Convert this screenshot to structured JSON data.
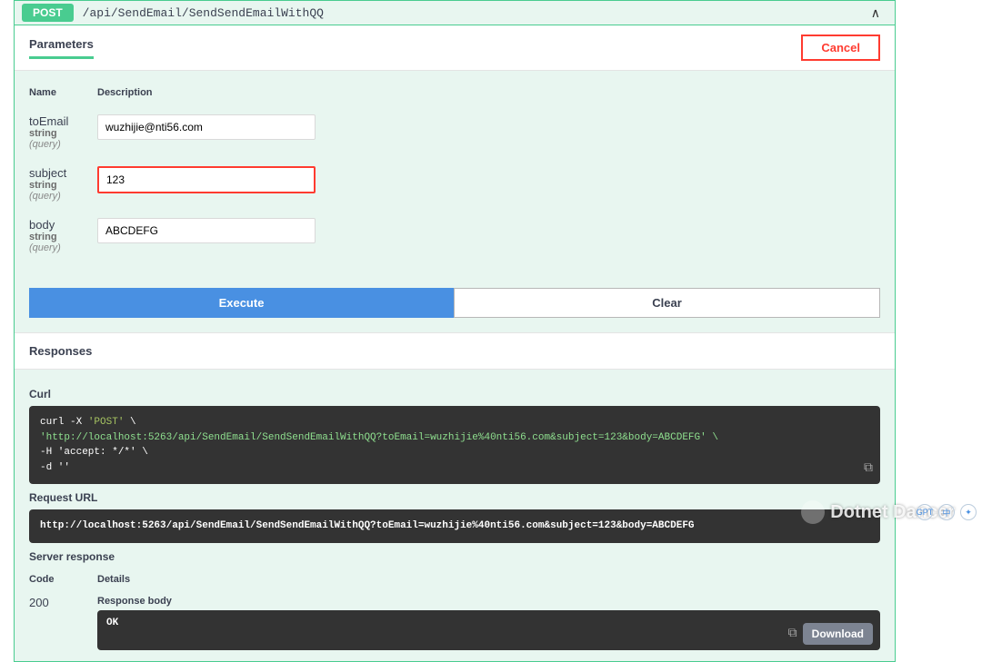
{
  "op": {
    "method": "POST",
    "path": "/api/SendEmail/SendSendEmailWithQQ"
  },
  "parameters": {
    "heading": "Parameters",
    "cancel": "Cancel",
    "cols": {
      "name": "Name",
      "desc": "Description"
    },
    "rows": [
      {
        "name": "toEmail",
        "type": "string",
        "in": "(query)",
        "value": "wuzhijie@nti56.com"
      },
      {
        "name": "subject",
        "type": "string",
        "in": "(query)",
        "value": "123"
      },
      {
        "name": "body",
        "type": "string",
        "in": "(query)",
        "value": "ABCDEFG"
      }
    ]
  },
  "buttons": {
    "execute": "Execute",
    "clear": "Clear"
  },
  "responses": {
    "heading": "Responses",
    "curl_label": "Curl",
    "curl_lines": {
      "l1a": "curl -X ",
      "l1b": "'POST'",
      "l1c": " \\",
      "l2": "  'http://localhost:5263/api/SendEmail/SendSendEmailWithQQ?toEmail=wuzhijie%40nti56.com&subject=123&body=ABCDEFG' \\",
      "l3": "  -H 'accept: */*' \\",
      "l4": "  -d ''"
    },
    "url_label": "Request URL",
    "url": "http://localhost:5263/api/SendEmail/SendSendEmailWithQQ?toEmail=wuzhijie%40nti56.com&subject=123&body=ABCDEFG",
    "server_label": "Server response",
    "cols": {
      "code": "Code",
      "details": "Details"
    },
    "row": {
      "code": "200",
      "body_label": "Response body",
      "body": "OK",
      "download": "Download"
    }
  },
  "watermark": "Dotnet Dancer",
  "side": {
    "a": "GPT",
    "b": "中",
    "c": "✦"
  }
}
